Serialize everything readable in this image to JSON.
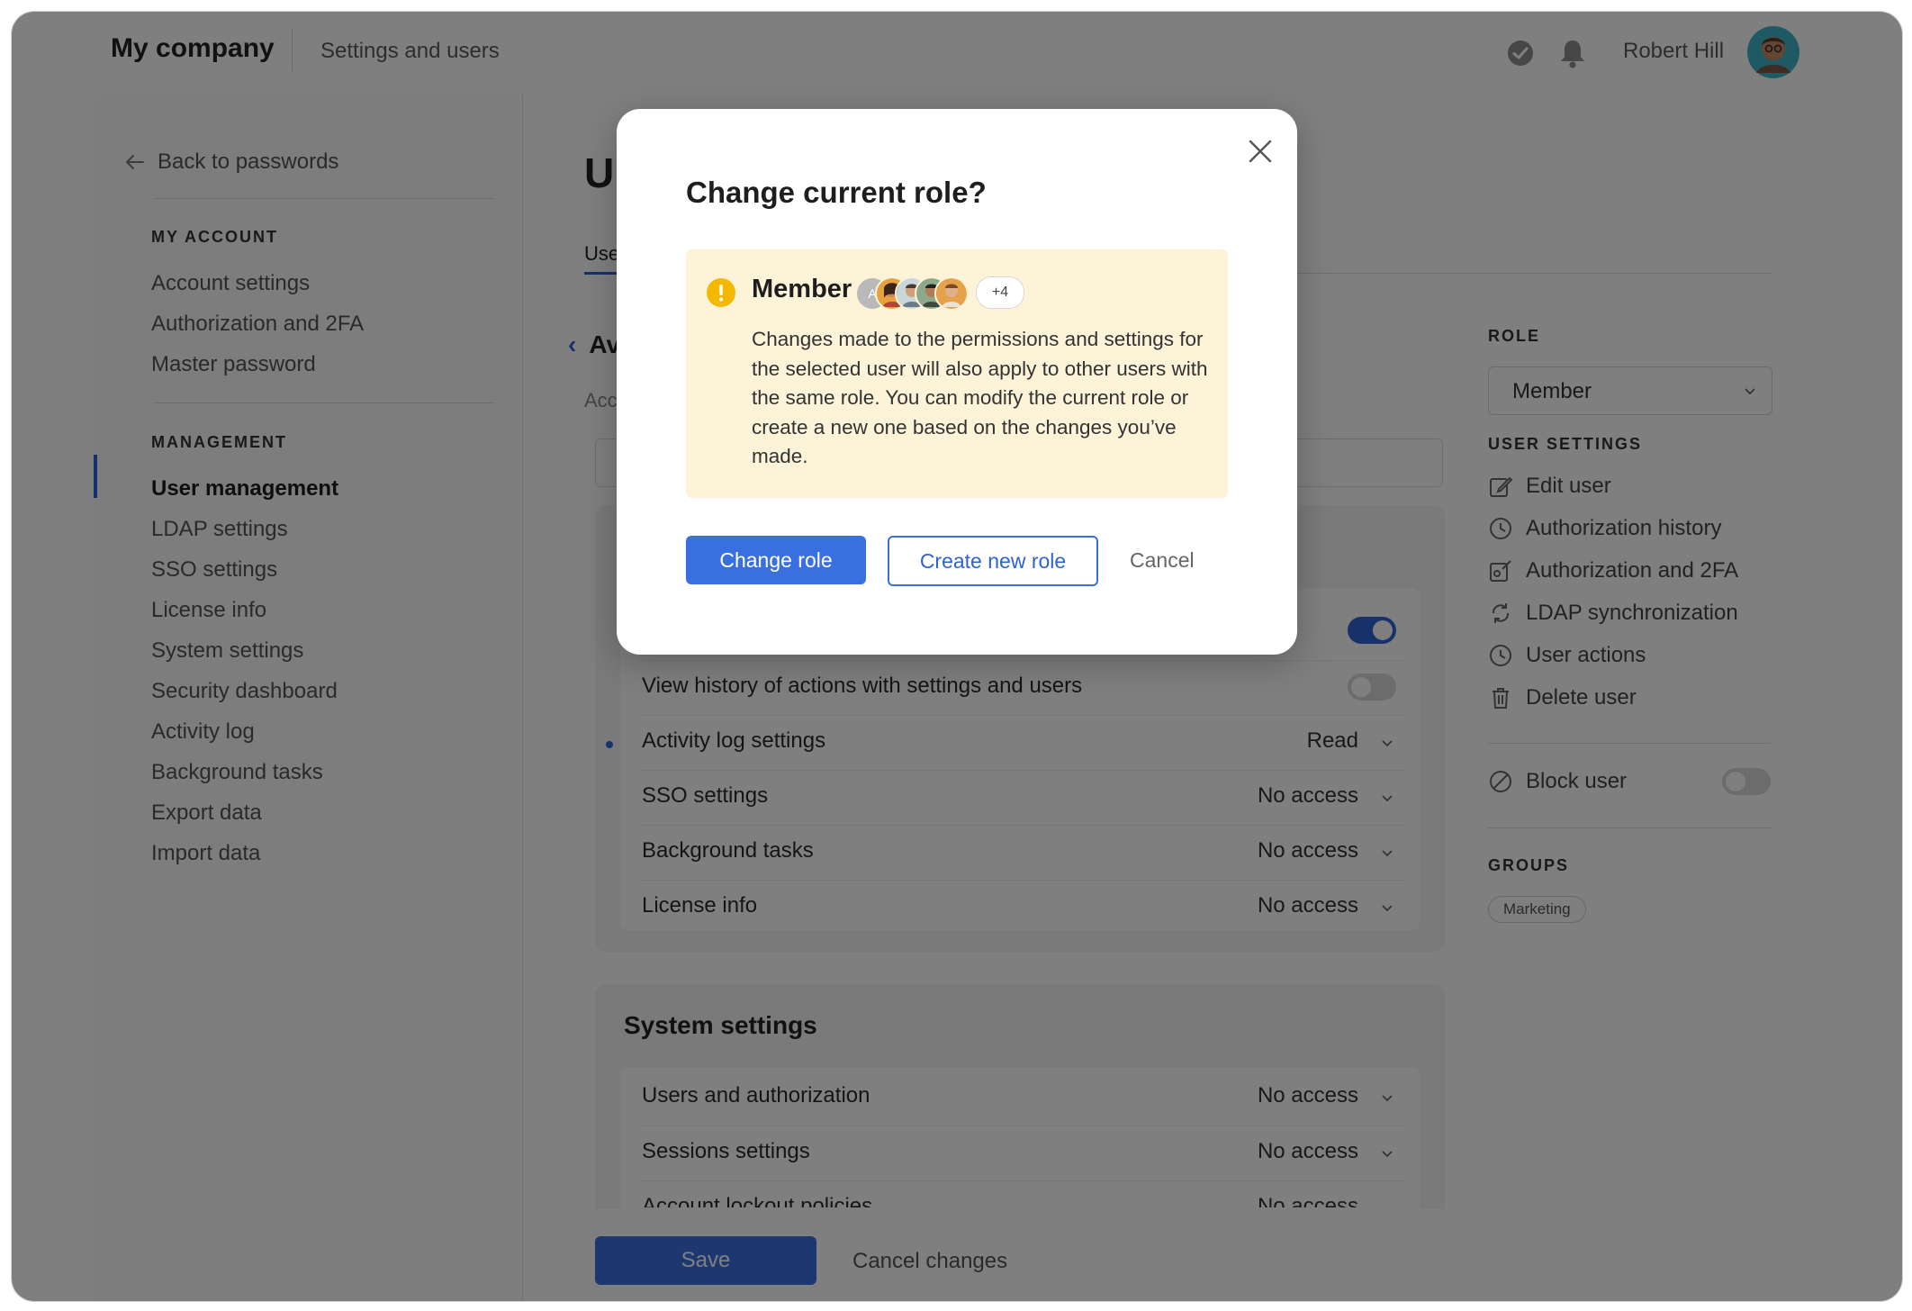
{
  "topbar": {
    "brand": "My company",
    "crumb": "Settings and users",
    "user_name": "Robert Hill"
  },
  "sidebar": {
    "back": "Back to passwords",
    "my_account_head": "MY ACCOUNT",
    "my_account_items": [
      "Account settings",
      "Authorization and 2FA",
      "Master password"
    ],
    "management_head": "MANAGEMENT",
    "management_items": [
      "User management",
      "LDAP settings",
      "SSO settings",
      "License info",
      "System settings",
      "Security dashboard",
      "Activity log",
      "Background tasks",
      "Export data",
      "Import data"
    ],
    "active_item": "User management"
  },
  "main": {
    "title_partial": "U",
    "tab_partial": "Use",
    "sub_back_partial": "Av",
    "sub_text_partial": "Acc",
    "permissions": [
      {
        "label": "View history of actions with settings and users",
        "type": "toggle",
        "on": false
      },
      {
        "label": "Activity log settings",
        "value": "Read",
        "modified": true
      },
      {
        "label": "SSO settings",
        "value": "No access"
      },
      {
        "label": "Background tasks",
        "value": "No access"
      },
      {
        "label": "License info",
        "value": "No access"
      }
    ],
    "top_toggle_on": true,
    "system_settings_title": "System settings",
    "system_rows": [
      {
        "label": "Users and authorization",
        "value": "No access"
      },
      {
        "label": "Sessions settings",
        "value": "No access"
      },
      {
        "label": "Account lockout policies",
        "value": "No access"
      }
    ],
    "save": "Save",
    "cancel_changes": "Cancel changes"
  },
  "right": {
    "role_head": "ROLE",
    "role_value": "Member",
    "user_settings_head": "USER SETTINGS",
    "items": [
      {
        "label": "Edit user",
        "icon": "edit-icon"
      },
      {
        "label": "Authorization history",
        "icon": "clock-icon"
      },
      {
        "label": "Authorization and 2FA",
        "icon": "key-edit-icon"
      },
      {
        "label": "LDAP synchronization",
        "icon": "sync-icon"
      },
      {
        "label": "User actions",
        "icon": "clock-icon"
      },
      {
        "label": "Delete user",
        "icon": "trash-icon"
      }
    ],
    "block_user": "Block user",
    "groups_head": "GROUPS",
    "group_tag": "Marketing"
  },
  "modal": {
    "title": "Change current role?",
    "role_name": "Member",
    "avatar_letter": "A",
    "more_count": "+4",
    "warning": "Changes made to the permissions and settings for the selected user will also apply to other users with the same role. You can modify the current role or create a new one based on the changes you’ve made.",
    "change_role": "Change role",
    "create_new_role": "Create new role",
    "cancel": "Cancel"
  },
  "colors": {
    "accent": "#3a6fe0",
    "warning_bg": "#fdf3d8",
    "warning_icon": "#f5b800",
    "overlay": "rgba(0,0,0,0.5)"
  }
}
